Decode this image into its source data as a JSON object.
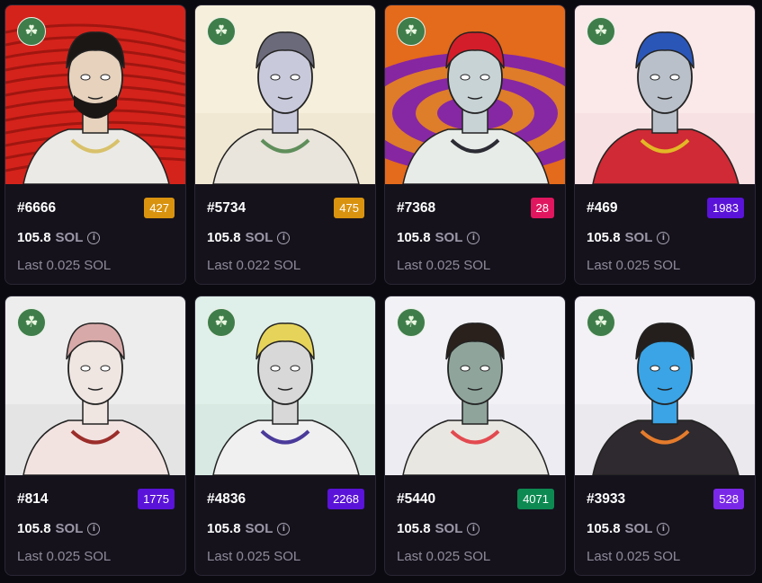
{
  "colors": {
    "gold": "#d9930f",
    "pink": "#e0175f",
    "purple": "#5a13d8",
    "green": "#0d8a52",
    "violet": "#7a28e8"
  },
  "cards": [
    {
      "number": "#6666",
      "rank": "427",
      "rank_color": "#d9930f",
      "price": "105.8",
      "currency": "SOL",
      "last": "Last 0.025 SOL",
      "bg": "#d4231b",
      "bg2": "#7d0d0a",
      "skin": "#e6d2bd",
      "hair": "#1b1715",
      "shirt": "#ebeae6",
      "accent": "#d8c16a"
    },
    {
      "number": "#5734",
      "rank": "475",
      "rank_color": "#d9930f",
      "price": "105.8",
      "currency": "SOL",
      "last": "Last 0.022 SOL",
      "bg": "#f6efdc",
      "bg2": "#e9e1c8",
      "skin": "#c9c9dc",
      "hair": "#6a6a7a",
      "shirt": "#e9e4dc",
      "accent": "#5f8e5b"
    },
    {
      "number": "#7368",
      "rank": "28",
      "rank_color": "#e0175f",
      "price": "105.8",
      "currency": "SOL",
      "last": "Last 0.025 SOL",
      "bg": "#e46a1c",
      "bg2": "#7a1ea3",
      "skin": "#c8d3d6",
      "hair": "#d41d2a",
      "shirt": "#e8ece8",
      "accent": "#2c2c34"
    },
    {
      "number": "#469",
      "rank": "1983",
      "rank_color": "#5a13d8",
      "price": "105.8",
      "currency": "SOL",
      "last": "Last 0.025 SOL",
      "bg": "#fbe9ea",
      "bg2": "#f4d9dc",
      "skin": "#b9c0c9",
      "hair": "#2a56b8",
      "shirt": "#cf2a35",
      "accent": "#e3b826"
    },
    {
      "number": "#814",
      "rank": "1775",
      "rank_color": "#5a13d8",
      "price": "105.8",
      "currency": "SOL",
      "last": "Last 0.025 SOL",
      "bg": "#ededed",
      "bg2": "#dcdcdc",
      "skin": "#efe6e2",
      "hair": "#d7a9a8",
      "shirt": "#f2e3e1",
      "accent": "#9b2d2a"
    },
    {
      "number": "#4836",
      "rank": "2268",
      "rank_color": "#5a13d8",
      "price": "105.8",
      "currency": "SOL",
      "last": "Last 0.025 SOL",
      "bg": "#dfefe9",
      "bg2": "#cfe3dc",
      "skin": "#d8d8d8",
      "hair": "#e6d45a",
      "shirt": "#f0f0f0",
      "accent": "#4a3a9a"
    },
    {
      "number": "#5440",
      "rank": "4071",
      "rank_color": "#0d8a52",
      "price": "105.8",
      "currency": "SOL",
      "last": "Last 0.025 SOL",
      "bg": "#f2f2f6",
      "bg2": "#e6e6ee",
      "skin": "#8fa59c",
      "hair": "#2a211c",
      "shirt": "#e9e7e1",
      "accent": "#e24a50"
    },
    {
      "number": "#3933",
      "rank": "528",
      "rank_color": "#7a28e8",
      "price": "105.8",
      "currency": "SOL",
      "last": "Last 0.025 SOL",
      "bg": "#f3f1f5",
      "bg2": "#e4e1e8",
      "skin": "#3aa4e6",
      "hair": "#241f1c",
      "shirt": "#2f2a2f",
      "accent": "#e57c2c"
    }
  ],
  "icon_names": {
    "clover": "clover-icon",
    "info": "info-icon"
  },
  "clover_glyph": "☘",
  "info_glyph": "i"
}
